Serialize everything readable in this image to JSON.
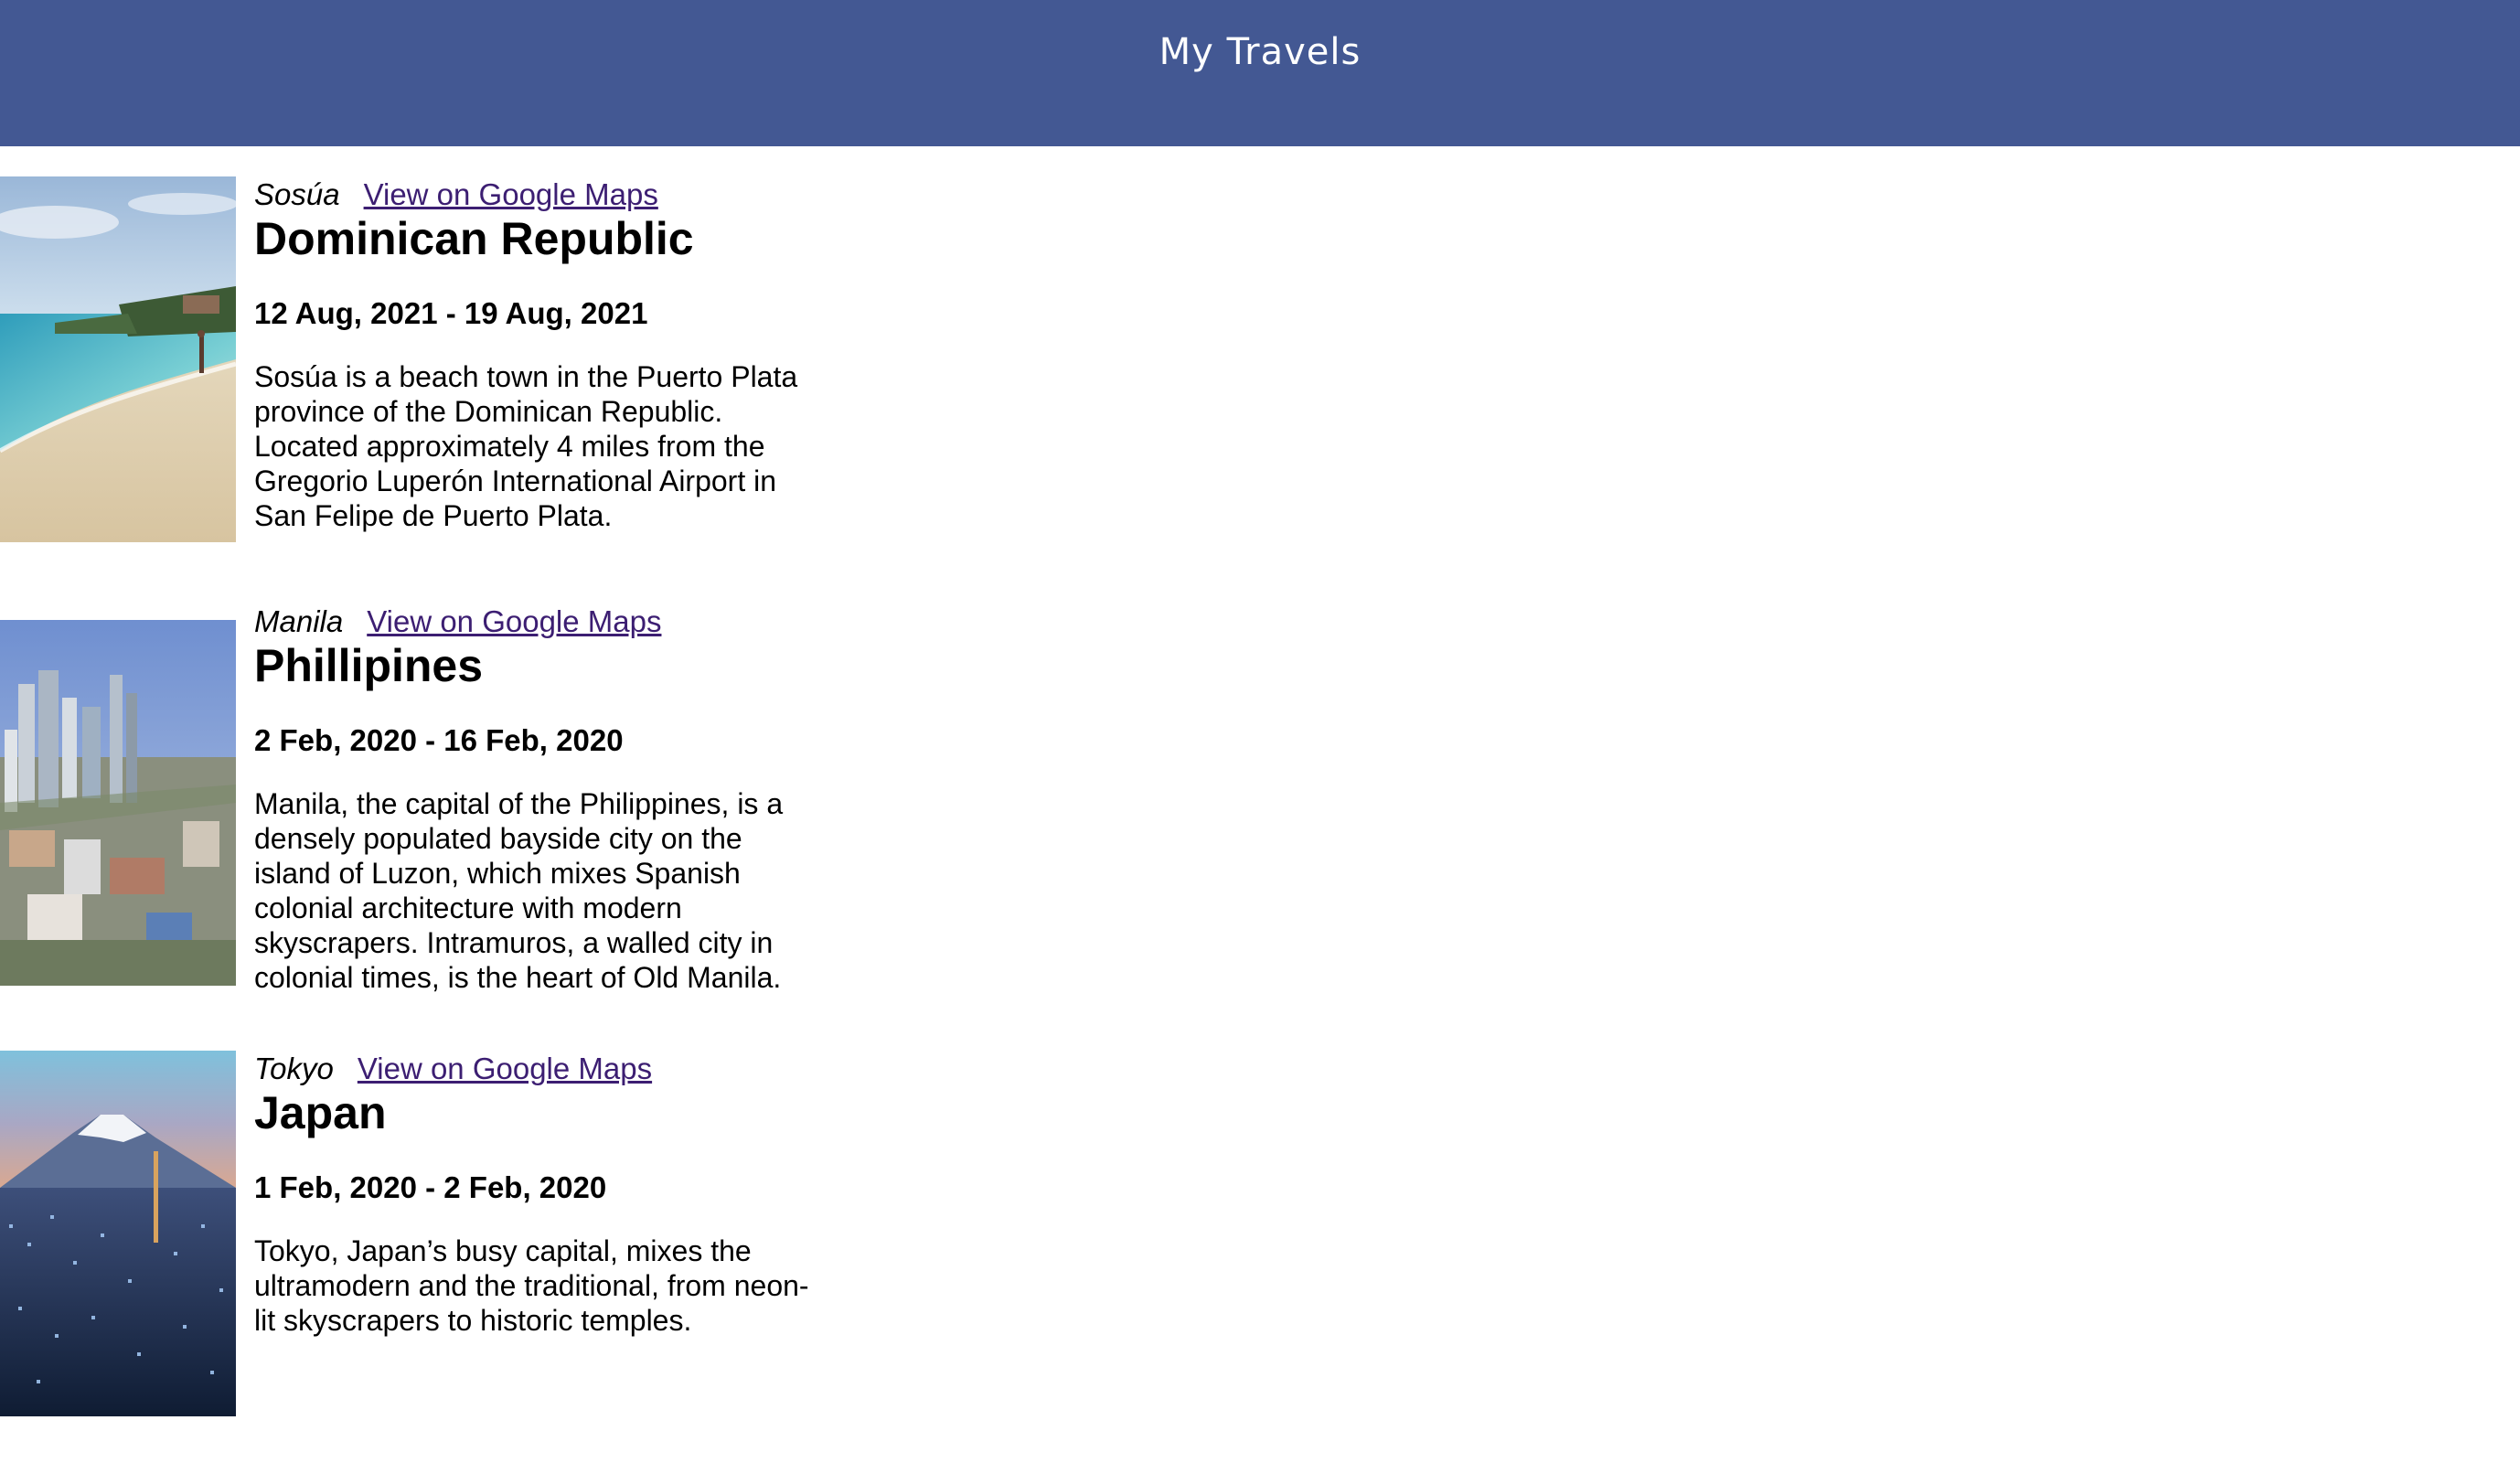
{
  "header": {
    "title": "My Travels"
  },
  "entries": [
    {
      "location": "Sosúa",
      "link_label": "View on Google Maps",
      "country": "Dominican Republic",
      "dates": "12 Aug, 2021 - 19 Aug, 2021",
      "description": "Sosúa is a beach town in the Puerto Plata province of the Dominican Republic. Located approximately 4 miles from the Gregorio Luperón International Airport in San Felipe de Puerto Plata.",
      "image_alt": "beach photo"
    },
    {
      "location": "Manila",
      "link_label": "View on Google Maps",
      "country": "Phillipines",
      "dates": "2 Feb, 2020 - 16 Feb, 2020",
      "description": "Manila, the capital of the Philippines, is a densely populated bayside city on the island of Luzon, which mixes Spanish colonial architecture with modern skyscrapers. Intramuros, a walled city in colonial times, is the heart of Old Manila.",
      "image_alt": "city skyline photo"
    },
    {
      "location": "Tokyo",
      "link_label": "View on Google Maps",
      "country": "Japan",
      "dates": "1 Feb, 2020 - 2 Feb, 2020",
      "description": "Tokyo, Japan’s busy capital, mixes the ultramodern and the traditional, from neon-lit skyscrapers to historic temples.",
      "image_alt": "mountain and city photo"
    }
  ],
  "colors": {
    "header_bg": "#435893",
    "link": "#3c1e72"
  }
}
